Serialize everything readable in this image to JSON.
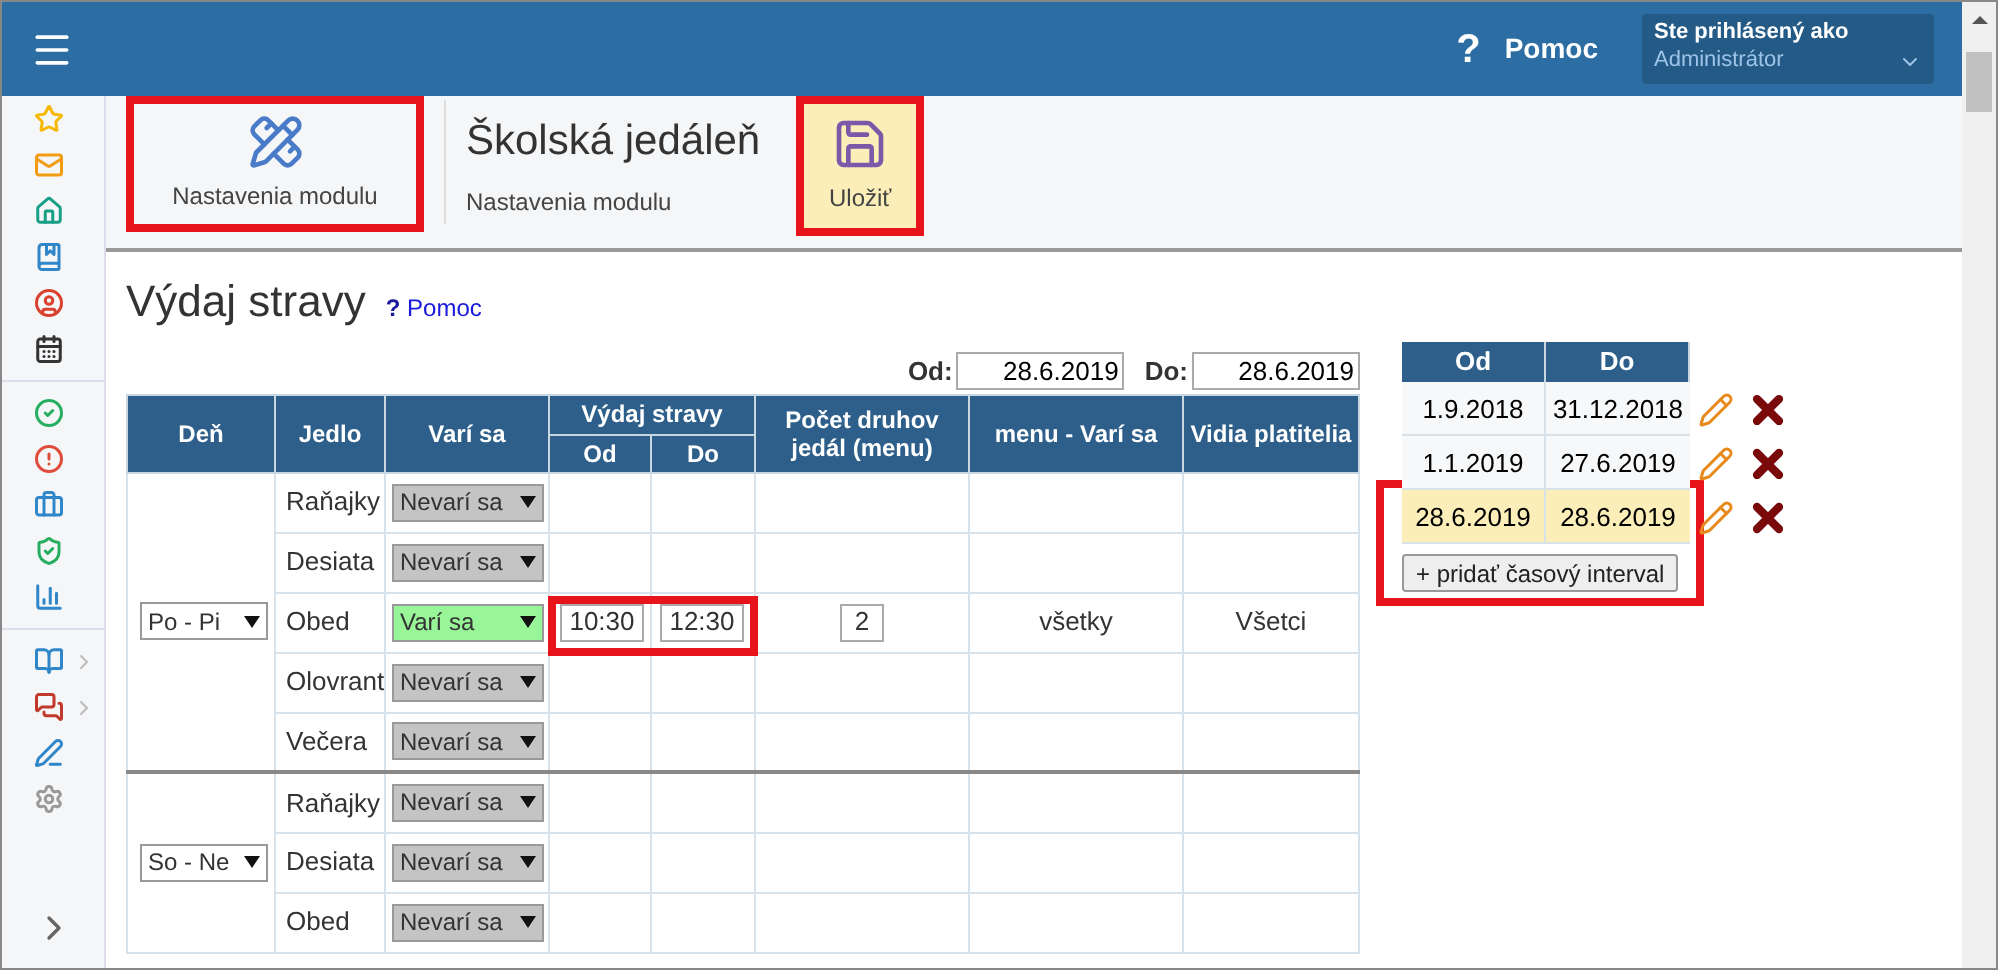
{
  "header": {
    "help_icon": "?",
    "help": "Pomoc",
    "user_caption": "Ste prihlásený ako",
    "user_name": "Administrátor"
  },
  "toolbar": {
    "settings_button": {
      "label": "Nastavenia modulu",
      "highlighted": true
    },
    "title": "Školská jedáleň",
    "subtitle": "Nastavenia modulu",
    "save_button": {
      "label": "Uložiť",
      "highlighted": true
    }
  },
  "page": {
    "title": "Výdaj stravy",
    "help_mark": "?",
    "help_link": "Pomoc"
  },
  "date_range": {
    "from_label": "Od:",
    "from": "28.6.2019",
    "to_label": "Do:",
    "to": "28.6.2019"
  },
  "table": {
    "columns": [
      "Deň",
      "Jedlo",
      "Varí sa",
      "Výdaj stravy",
      "Počet druhov jedál (menu)",
      "menu - Varí sa",
      "Vidia platitelia"
    ],
    "subcolumns": [
      "Od",
      "Do"
    ],
    "groups": [
      {
        "day": "Po - Pi",
        "meals": [
          {
            "name": "Raňajky",
            "cooking": {
              "label": "Nevarí sa",
              "on": false
            }
          },
          {
            "name": "Desiata",
            "cooking": {
              "label": "Nevarí sa",
              "on": false
            }
          },
          {
            "name": "Obed",
            "cooking": {
              "label": "Varí sa",
              "on": true
            },
            "from": "10:30",
            "to": "12:30",
            "highlighted": true,
            "count": "2",
            "menu": "všetky",
            "payers": "Všetci"
          },
          {
            "name": "Olovrant",
            "cooking": {
              "label": "Nevarí sa",
              "on": false
            }
          },
          {
            "name": "Večera",
            "cooking": {
              "label": "Nevarí sa",
              "on": false
            }
          }
        ]
      },
      {
        "day": "So - Ne",
        "meals": [
          {
            "name": "Raňajky",
            "cooking": {
              "label": "Nevarí sa",
              "on": false
            }
          },
          {
            "name": "Desiata",
            "cooking": {
              "label": "Nevarí sa",
              "on": false
            }
          },
          {
            "name": "Obed",
            "cooking": {
              "label": "Nevarí sa",
              "on": false
            }
          }
        ]
      }
    ]
  },
  "intervals": {
    "columns": [
      "Od",
      "Do"
    ],
    "highlighted": true,
    "add_button": "+ pridať časový interval",
    "rows": [
      {
        "from": "1.9.2018",
        "to": "31.12.2018",
        "selected": false
      },
      {
        "from": "1.1.2019",
        "to": "27.6.2019",
        "selected": false
      },
      {
        "from": "28.6.2019",
        "to": "28.6.2019",
        "selected": true
      }
    ]
  }
}
